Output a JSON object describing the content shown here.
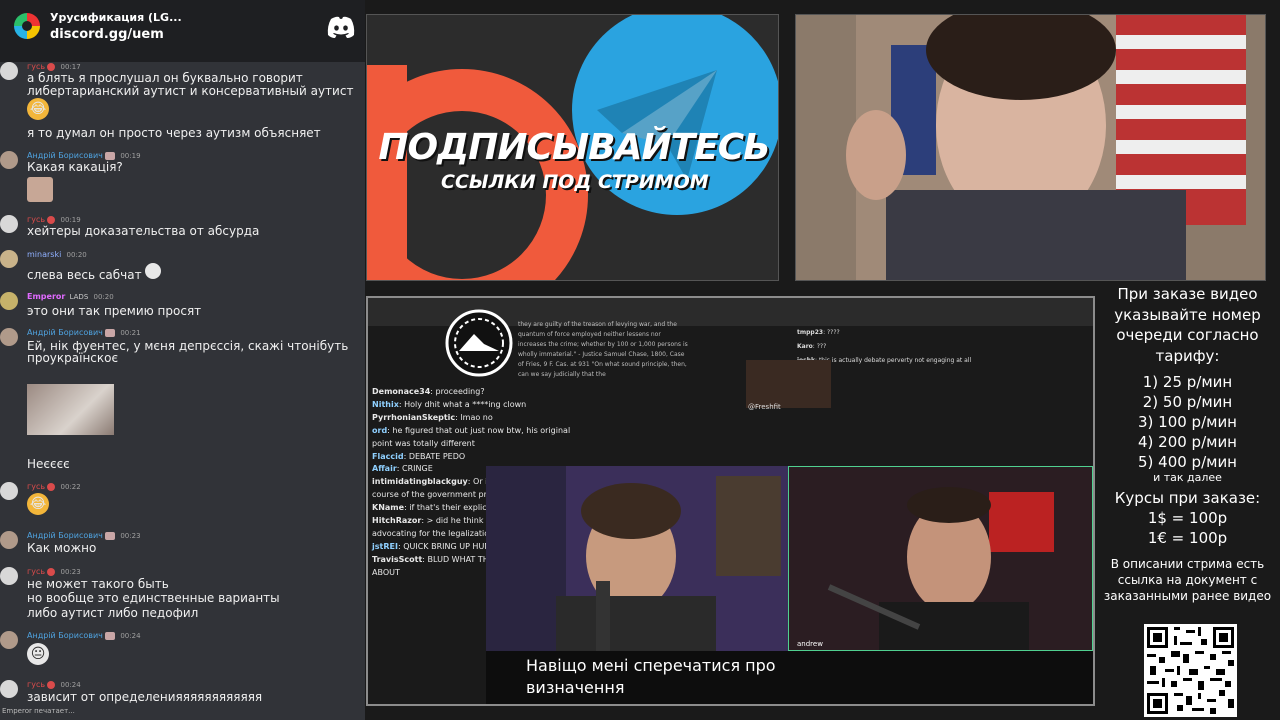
{
  "chat": {
    "server_name": "Урусификация (LG...",
    "invite": "discord.gg/uem",
    "messages": [
      {
        "nick": "гусь",
        "nick_color": "#d94b4b",
        "time": "00:17",
        "lines": [
          "а блять я прослушал он буквально говорит",
          "либертарианский аутист и консервативный аутист"
        ],
        "emoji": "😂",
        "extra_line": "я то думал он просто через аутизм объясняет"
      },
      {
        "nick": "Андрій Борисович",
        "nick_color": "#4fa3e0",
        "time": "00:19",
        "lines": [
          "Какая какація?"
        ]
      },
      {
        "nick": "гусь",
        "nick_color": "#d94b4b",
        "time": "00:19",
        "lines": [
          "хейтеры доказательства от абсурда"
        ]
      },
      {
        "nick": "minarski",
        "nick_color": "#8fb0ff",
        "time": "00:20",
        "lines": [
          "слева весь сабчат"
        ]
      },
      {
        "nick": "Emperor",
        "nick_color": "#e06aff",
        "time": "00:20",
        "tag": "LADS",
        "lines": [
          "это они так премию просят"
        ]
      },
      {
        "nick": "Андрій Борисович",
        "nick_color": "#4fa3e0",
        "time": "00:21",
        "lines": [
          "Ей, нік фуентес, у мєня депрєссія, скажі чтонібуть",
          "проукраїнскоє"
        ],
        "extra_line": "Неєєєє"
      },
      {
        "nick": "гусь",
        "nick_color": "#d94b4b",
        "time": "00:22",
        "emoji": "😂"
      },
      {
        "nick": "Андрій Борисович",
        "nick_color": "#4fa3e0",
        "time": "00:23",
        "lines": [
          "Как можно"
        ]
      },
      {
        "nick": "гусь",
        "nick_color": "#d94b4b",
        "time": "00:23",
        "lines": [
          "не может такого быть",
          "но вообще это единственные варианты",
          "либо аутист либо педофил"
        ]
      },
      {
        "nick": "Андрій Борисович",
        "nick_color": "#4fa3e0",
        "time": "00:24",
        "emoji": "😐"
      },
      {
        "nick": "гусь",
        "nick_color": "#d94b4b",
        "time": "00:24",
        "lines": [
          "зависит от определенияяяяяяяяяяяя"
        ]
      }
    ],
    "typing": "Emperor печатает..."
  },
  "promo": {
    "title": "ПОДПИСЫВАЙТЕСЬ",
    "subtitle": "ССЫЛКИ ПОД СТРИМОМ"
  },
  "stream": {
    "quote": "they are guilty of the treason of levying war, and the quantum of force employed neither lessens nor increases the crime; whether by 100 or 1,000 persons is wholly immaterial.\" - Justice Samuel Chase, 1800, Case of Fries, 9 F. Cas. at 931  \"On what sound principle, then, can we say judicially that the",
    "chat": [
      {
        "user": "Demonace34",
        "color": "#e8e8e8",
        "text": "proceeding?"
      },
      {
        "user": "Nithix",
        "color": "#8fd0ff",
        "text": "Holy dhit what a ****ing clown"
      },
      {
        "user": "PyrrhonianSkeptic",
        "color": "#e8e8e8",
        "text": "lmao no"
      },
      {
        "user": "ord",
        "color": "#8fd0ff",
        "text": "he figured that out just now btw, his original point was totally different"
      },
      {
        "user": "Flaccid",
        "color": "#8fd0ff",
        "text": "DEBATE PEDO"
      },
      {
        "user": "Affair",
        "color": "#8fd0ff",
        "text": "CRINGE"
      },
      {
        "user": "intimidatingblackguy",
        "color": "#e8e8e8",
        "text": "Or interfering with the course of the government proceeding."
      },
      {
        "user": "KName",
        "color": "#e8e8e8",
        "text": "if that's their explicit goal sure"
      },
      {
        "user": "HitchRazor",
        "color": "#e8e8e8",
        "text": "> did he think that BLM protests were advocating for the legalization of arson?"
      },
      {
        "user": "jstREI",
        "color": "#8fd0ff",
        "text": "QUICK BRING UP HUNTER BIDEN"
      },
      {
        "user": "TravisScott",
        "color": "#e8e8e8",
        "text": "BLUD WHAT THE **** ARE YOU TALKING ABOUT"
      }
    ],
    "right_chat": [
      {
        "user": "tmpp23",
        "text": "????"
      },
      {
        "user": "Karo",
        "text": "???"
      },
      {
        "user": "joshk",
        "text": "this is actually debate perverty   not engaging at all"
      }
    ],
    "freshfit": "@Freshfit",
    "cam_right_name": "andrew",
    "caption": "Навіщо мені сперечатися про визначення"
  },
  "info": {
    "intro": "При заказе видео указывайте номер очереди согласно тарифу:",
    "prices": [
      "1) 25 р/мин",
      "2) 50 р/мин",
      "3) 100 р/мин",
      "4) 200 р/мин",
      "5) 400 р/мин"
    ],
    "etc": "и так далее",
    "courses_title": "Курсы при заказе:",
    "courses": [
      "1$ = 100р",
      "1€ = 100р"
    ],
    "desc": "В описании стрима есть ссылка на документ с заказанными ранее видео"
  },
  "colors": {
    "discord_bg": "#313338",
    "header_bg": "#1e1f22",
    "telegram_blue": "#2aa3e0",
    "patreon_orange": "#f05a3c"
  }
}
